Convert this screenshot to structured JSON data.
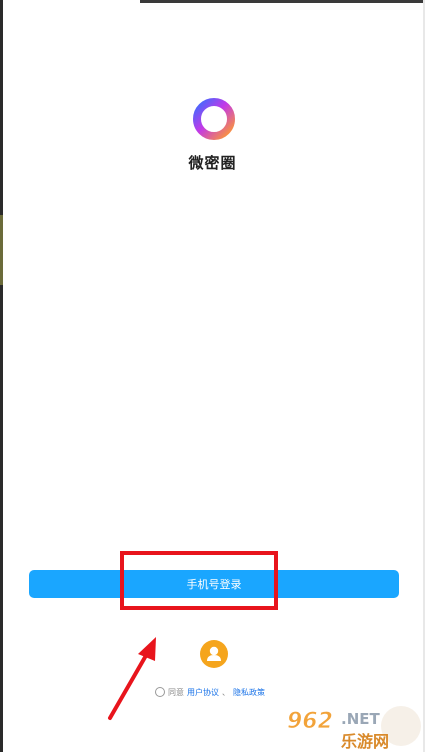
{
  "app": {
    "name": "微密圈"
  },
  "login": {
    "phone_button_label": "手机号登录"
  },
  "agreement": {
    "prefix": "同意",
    "user_agreement": "用户协议",
    "separator": "、",
    "privacy_policy": "隐私政策"
  },
  "watermark": {
    "number": "962",
    "domain": ".NET",
    "cn": "乐游网"
  },
  "colors": {
    "primary": "#1aa6ff",
    "guest": "#f5a51d",
    "annotation": "#e8141c",
    "link": "#1a73e8"
  },
  "icons": {
    "logo": "ring-gradient-icon",
    "guest": "user-icon",
    "annotation": "red-arrow-icon"
  }
}
